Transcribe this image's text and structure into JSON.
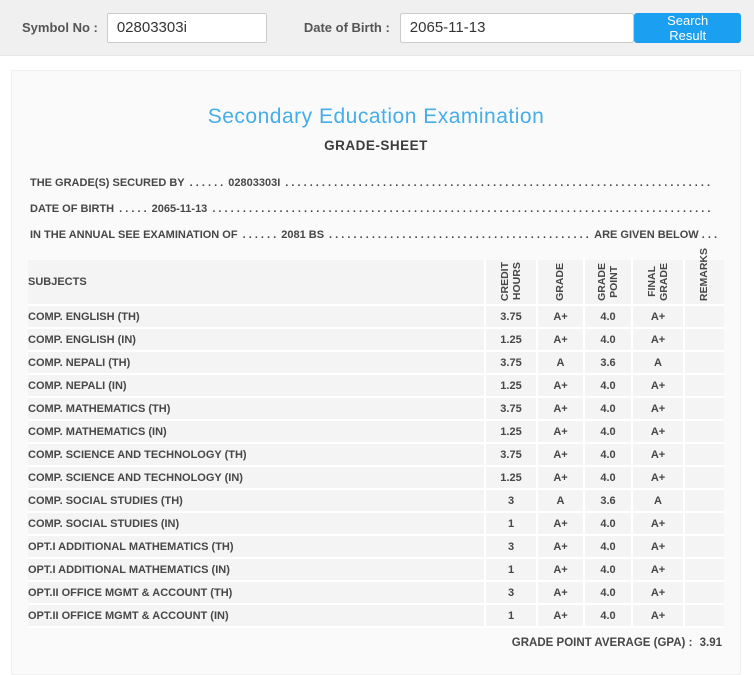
{
  "search_bar": {
    "symbol_label": "Symbol No :",
    "symbol_value": "02803303i",
    "dob_label": "Date of Birth :",
    "dob_value": "2065-11-13",
    "button_label": "Search Result"
  },
  "grade_sheet": {
    "title": "Secondary Education Examination",
    "subtitle": "GRADE-SHEET",
    "info_lines": [
      {
        "label": "THE GRADE(S) SECURED BY",
        "sep": ". . . . . .",
        "value": "02803303I",
        "suffix": ""
      },
      {
        "label": "DATE OF BIRTH",
        "sep": ". . . . .",
        "value": "2065-11-13",
        "suffix": ""
      },
      {
        "label": "IN THE ANNUAL SEE EXAMINATION OF",
        "sep": ". . . . . .",
        "value": "2081 BS",
        "suffix": "ARE GIVEN BELOW . . ."
      }
    ],
    "dot_leader": ". . . . . . . . . . . . . . . . . . . . . . . . . . . . . . . . . . . . . . . . . . . . . . . . . . . . . . . . . . . . . . . . . . . . . . . . . . . . . . . . . . . . . . . . . . . . . . . . . . . . . . . . . . . . . . . .",
    "table": {
      "headers": {
        "subject": "SUBJECTS",
        "credit_hours": "CREDIT\nHOURS",
        "grade": "GRADE",
        "grade_point": "GRADE\nPOINT",
        "final_grade": "FINAL\nGRADE",
        "remarks": "REMARKS"
      },
      "rows": [
        {
          "subject": "COMP. ENGLISH (TH)",
          "credit_hours": "3.75",
          "grade": "A+",
          "grade_point": "4.0",
          "final_grade": "A+",
          "remarks": ""
        },
        {
          "subject": "COMP. ENGLISH (IN)",
          "credit_hours": "1.25",
          "grade": "A+",
          "grade_point": "4.0",
          "final_grade": "A+",
          "remarks": ""
        },
        {
          "subject": "COMP. NEPALI (TH)",
          "credit_hours": "3.75",
          "grade": "A",
          "grade_point": "3.6",
          "final_grade": "A",
          "remarks": ""
        },
        {
          "subject": "COMP. NEPALI (IN)",
          "credit_hours": "1.25",
          "grade": "A+",
          "grade_point": "4.0",
          "final_grade": "A+",
          "remarks": ""
        },
        {
          "subject": "COMP. MATHEMATICS (TH)",
          "credit_hours": "3.75",
          "grade": "A+",
          "grade_point": "4.0",
          "final_grade": "A+",
          "remarks": ""
        },
        {
          "subject": "COMP. MATHEMATICS (IN)",
          "credit_hours": "1.25",
          "grade": "A+",
          "grade_point": "4.0",
          "final_grade": "A+",
          "remarks": ""
        },
        {
          "subject": "COMP. SCIENCE AND TECHNOLOGY (TH)",
          "credit_hours": "3.75",
          "grade": "A+",
          "grade_point": "4.0",
          "final_grade": "A+",
          "remarks": ""
        },
        {
          "subject": "COMP. SCIENCE AND TECHNOLOGY (IN)",
          "credit_hours": "1.25",
          "grade": "A+",
          "grade_point": "4.0",
          "final_grade": "A+",
          "remarks": ""
        },
        {
          "subject": "COMP. SOCIAL STUDIES (TH)",
          "credit_hours": "3",
          "grade": "A",
          "grade_point": "3.6",
          "final_grade": "A",
          "remarks": ""
        },
        {
          "subject": "COMP. SOCIAL STUDIES (IN)",
          "credit_hours": "1",
          "grade": "A+",
          "grade_point": "4.0",
          "final_grade": "A+",
          "remarks": ""
        },
        {
          "subject": "OPT.I ADDITIONAL MATHEMATICS (TH)",
          "credit_hours": "3",
          "grade": "A+",
          "grade_point": "4.0",
          "final_grade": "A+",
          "remarks": ""
        },
        {
          "subject": "OPT.I ADDITIONAL MATHEMATICS (IN)",
          "credit_hours": "1",
          "grade": "A+",
          "grade_point": "4.0",
          "final_grade": "A+",
          "remarks": ""
        },
        {
          "subject": "OPT.II OFFICE MGMT & ACCOUNT (TH)",
          "credit_hours": "3",
          "grade": "A+",
          "grade_point": "4.0",
          "final_grade": "A+",
          "remarks": ""
        },
        {
          "subject": "OPT.II OFFICE MGMT & ACCOUNT (IN)",
          "credit_hours": "1",
          "grade": "A+",
          "grade_point": "4.0",
          "final_grade": "A+",
          "remarks": ""
        }
      ]
    },
    "gpa_label": "GRADE POINT AVERAGE (GPA) :",
    "gpa_value": "3.91"
  },
  "colors": {
    "accent_blue": "#45aee8",
    "button_blue": "#1b9ff0",
    "bar_background": "#f0f0f0",
    "card_background": "#fafafa",
    "row_background": "#f4f4f4"
  }
}
